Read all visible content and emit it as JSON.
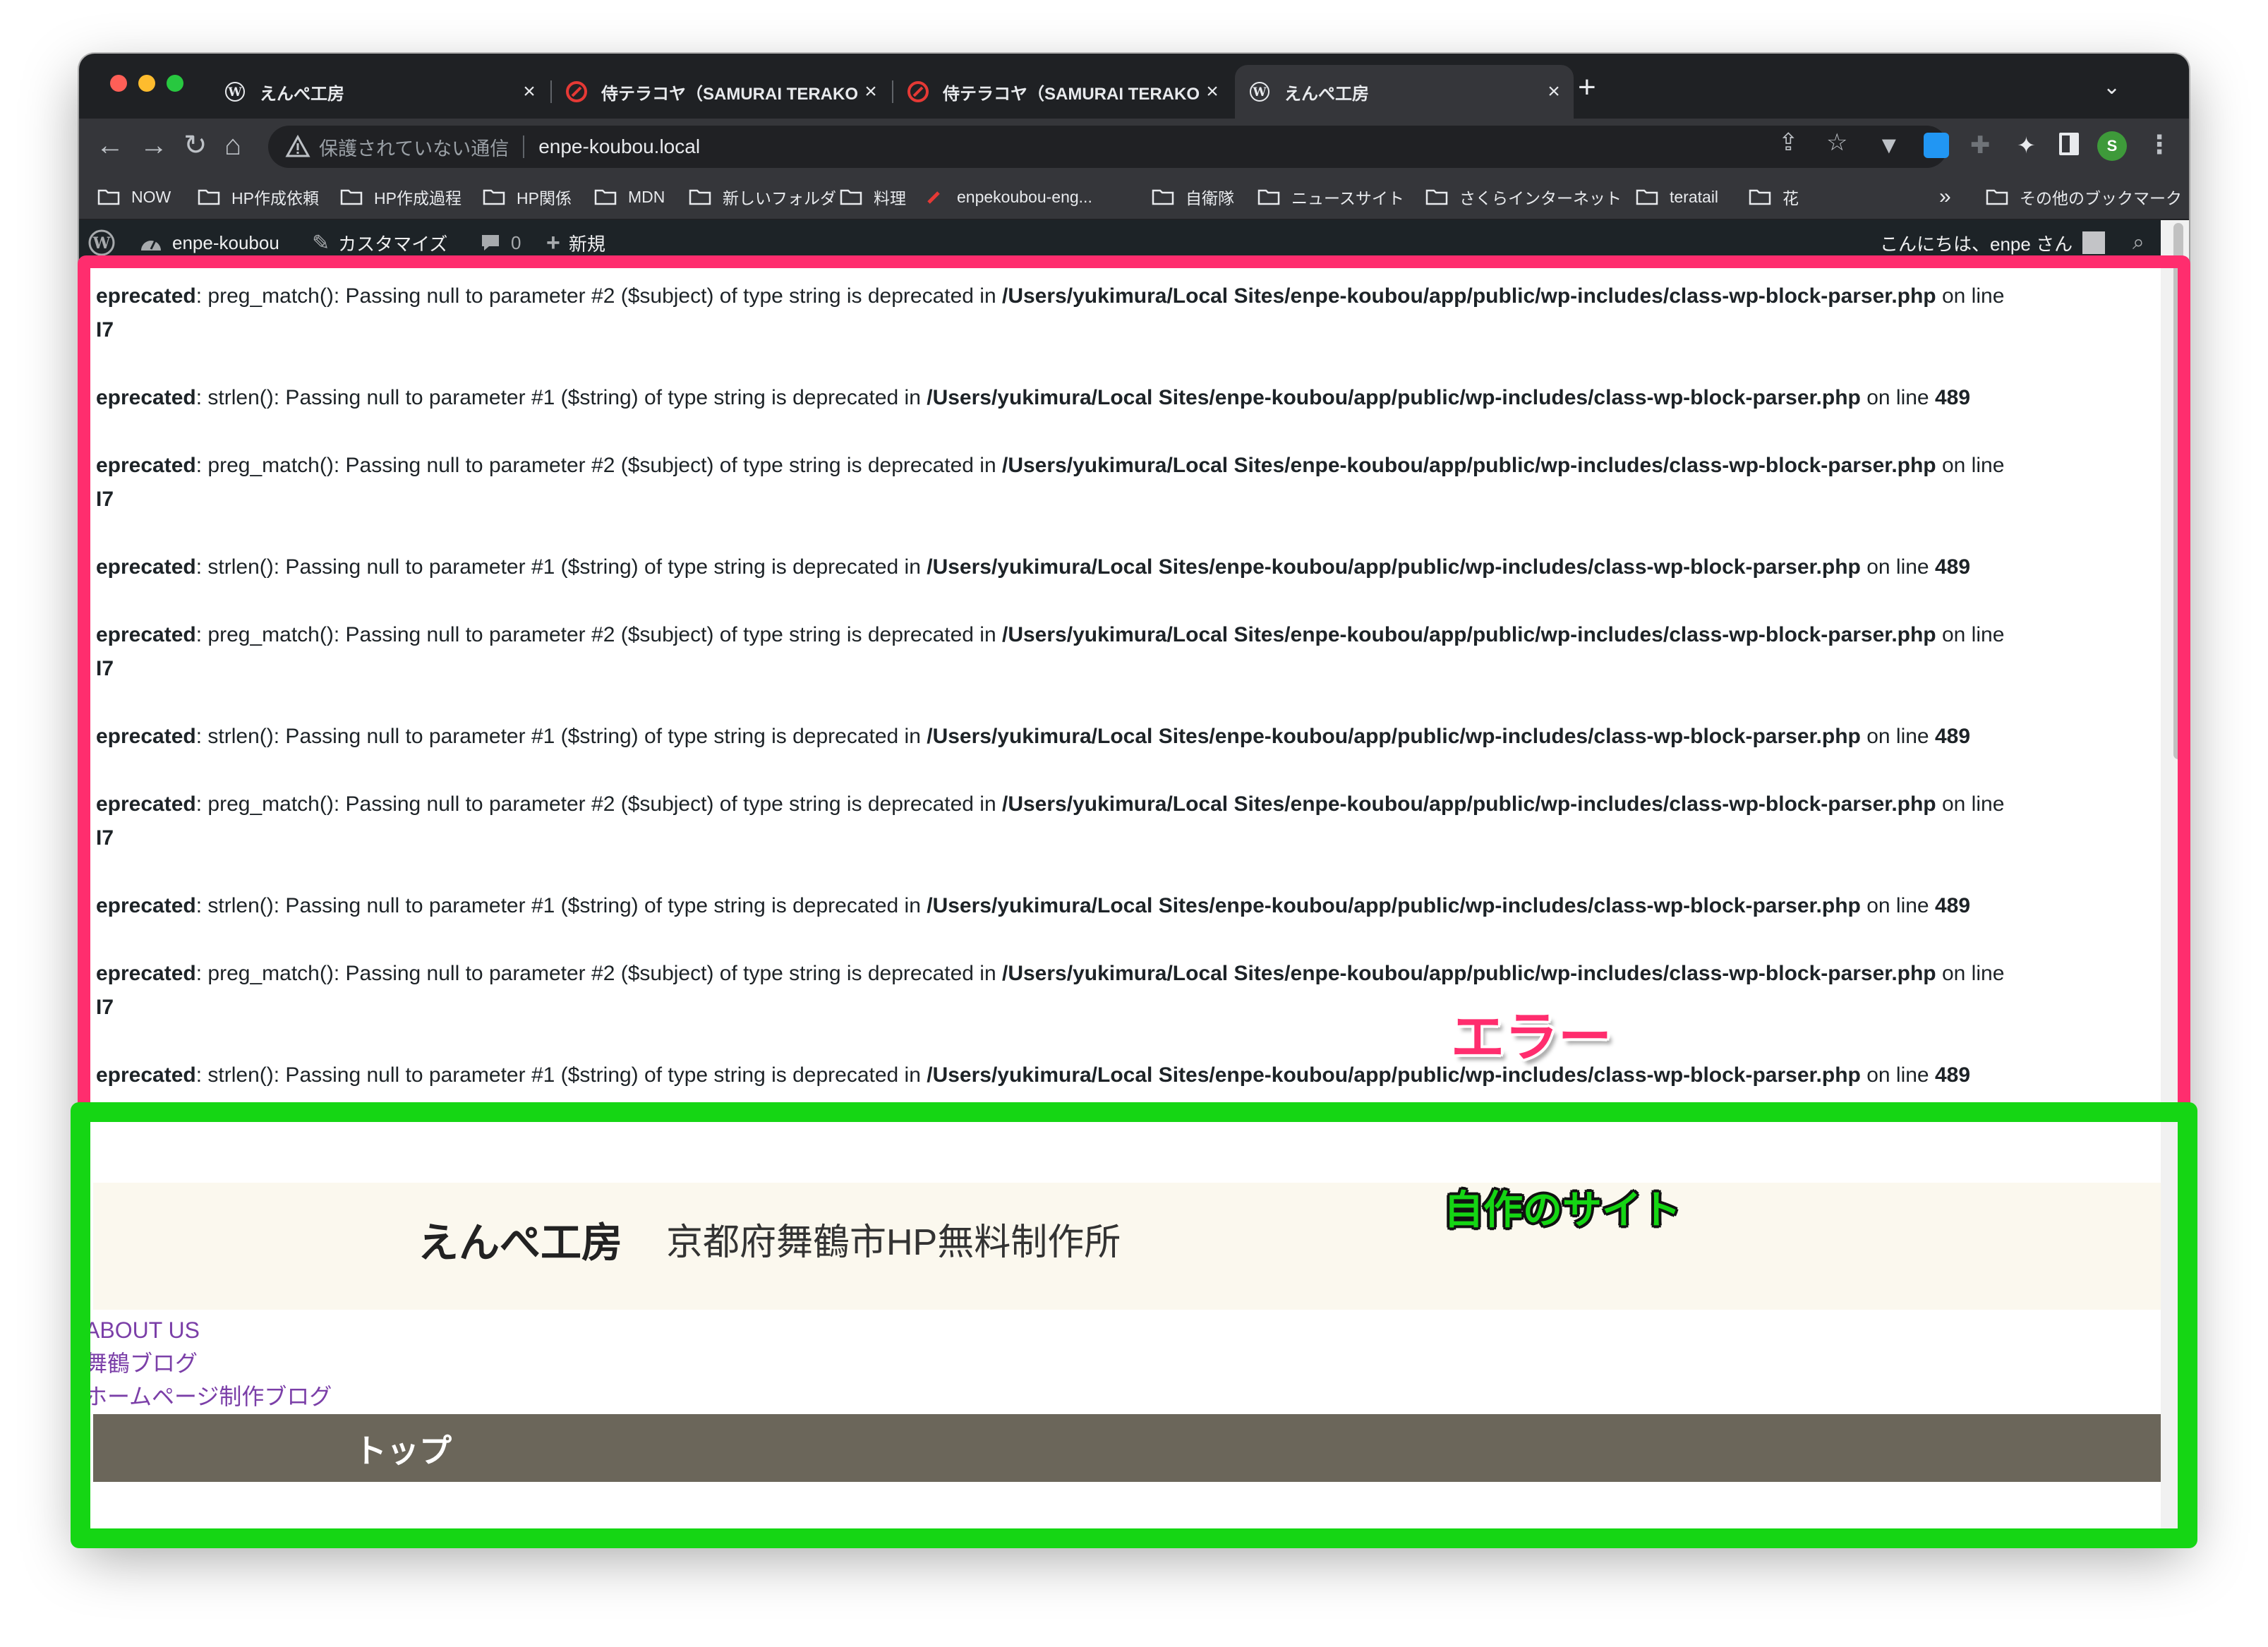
{
  "browser": {
    "tabs": [
      {
        "title": "えんぺ工房",
        "favicon": "wordpress-icon",
        "active": false
      },
      {
        "title": "侍テラコヤ（SAMURAI TERAKOYA）",
        "favicon": "samurai-icon",
        "active": false
      },
      {
        "title": "侍テラコヤ（SAMURAI TERAKOYA）",
        "favicon": "samurai-icon",
        "active": false
      },
      {
        "title": "えんぺ工房",
        "favicon": "wordpress-icon",
        "active": true
      }
    ],
    "close_glyph": "×",
    "new_tab_glyph": "+",
    "omnibox": {
      "security_text": "保護されていない通信",
      "url": "enpe-koubou.local"
    },
    "bookmarks": [
      "NOW",
      "HP作成依頼",
      "HP作成過程",
      "HP関係",
      "MDN",
      "新しいフォルダ",
      "料理",
      "enpekoubou-eng...",
      "自衛隊",
      "ニュースサイト",
      "さくらインターネット",
      "teratail",
      "花"
    ],
    "bookmarks_overflow": "»",
    "other_bookmarks": "その他のブックマーク",
    "profile_initial": "S"
  },
  "wp_admin_bar": {
    "site_name": "enpe-koubou",
    "customize": "カスタマイズ",
    "comments_count": "0",
    "new": "新規",
    "greeting": "こんにちは、enpe さん"
  },
  "errors": [
    {
      "label": "eprecated",
      "message": ": preg_match(): Passing null to parameter #2 ($subject) of type string is deprecated in ",
      "file": "/Users/yukimura/Local Sites/enpe-koubou/app/public/wp-includes/class-wp-block-parser.php",
      "on_line": " on line",
      "line": "I7"
    },
    {
      "label": "eprecated",
      "message": ": strlen(): Passing null to parameter #1 ($string) of type string is deprecated in ",
      "file": "/Users/yukimura/Local Sites/enpe-koubou/app/public/wp-includes/class-wp-block-parser.php",
      "on_line": " on line ",
      "line": "489"
    },
    {
      "label": "eprecated",
      "message": ": preg_match(): Passing null to parameter #2 ($subject) of type string is deprecated in ",
      "file": "/Users/yukimura/Local Sites/enpe-koubou/app/public/wp-includes/class-wp-block-parser.php",
      "on_line": " on line",
      "line": "I7"
    },
    {
      "label": "eprecated",
      "message": ": strlen(): Passing null to parameter #1 ($string) of type string is deprecated in ",
      "file": "/Users/yukimura/Local Sites/enpe-koubou/app/public/wp-includes/class-wp-block-parser.php",
      "on_line": " on line ",
      "line": "489"
    },
    {
      "label": "eprecated",
      "message": ": preg_match(): Passing null to parameter #2 ($subject) of type string is deprecated in ",
      "file": "/Users/yukimura/Local Sites/enpe-koubou/app/public/wp-includes/class-wp-block-parser.php",
      "on_line": " on line",
      "line": "I7"
    },
    {
      "label": "eprecated",
      "message": ": strlen(): Passing null to parameter #1 ($string) of type string is deprecated in ",
      "file": "/Users/yukimura/Local Sites/enpe-koubou/app/public/wp-includes/class-wp-block-parser.php",
      "on_line": " on line ",
      "line": "489"
    },
    {
      "label": "eprecated",
      "message": ": preg_match(): Passing null to parameter #2 ($subject) of type string is deprecated in ",
      "file": "/Users/yukimura/Local Sites/enpe-koubou/app/public/wp-includes/class-wp-block-parser.php",
      "on_line": " on line",
      "line": "I7"
    },
    {
      "label": "eprecated",
      "message": ": strlen(): Passing null to parameter #1 ($string) of type string is deprecated in ",
      "file": "/Users/yukimura/Local Sites/enpe-koubou/app/public/wp-includes/class-wp-block-parser.php",
      "on_line": " on line ",
      "line": "489"
    },
    {
      "label": "eprecated",
      "message": ": preg_match(): Passing null to parameter #2 ($subject) of type string is deprecated in ",
      "file": "/Users/yukimura/Local Sites/enpe-koubou/app/public/wp-includes/class-wp-block-parser.php",
      "on_line": " on line",
      "line": "I7"
    },
    {
      "label": "eprecated",
      "message": ": strlen(): Passing null to parameter #1 ($string) of type string is deprecated in ",
      "file": "/Users/yukimura/Local Sites/enpe-koubou/app/public/wp-includes/class-wp-block-parser.php",
      "on_line": " on line ",
      "line": "489"
    }
  ],
  "site": {
    "title": "えんぺ工房",
    "description": "京都府舞鶴市HP無料制作所",
    "nav": [
      "ABOUT US",
      "舞鶴ブログ",
      "ホームページ制作ブログ"
    ],
    "page_heading": "トップ"
  },
  "annotations": {
    "error_label": "エラー",
    "site_label": "自作のサイト",
    "error_color": "#ff2d6e",
    "site_color": "#15d614"
  }
}
